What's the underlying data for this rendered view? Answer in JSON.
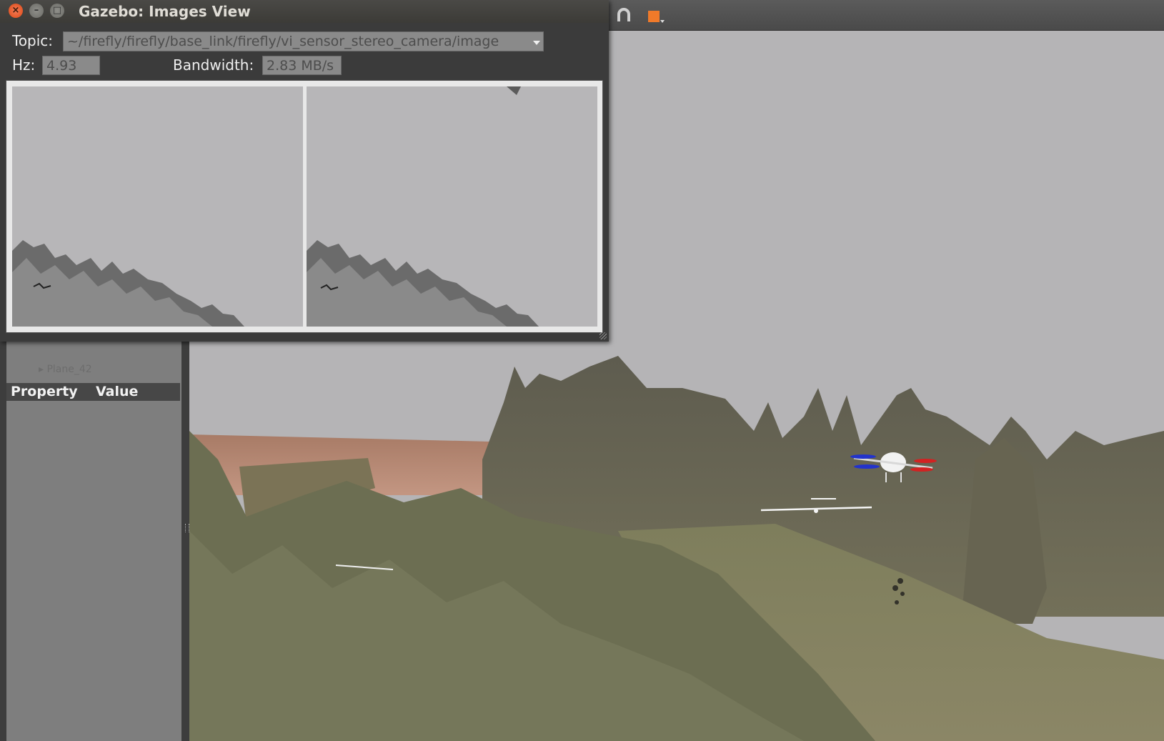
{
  "images_view": {
    "window_title": "Gazebo: Images View",
    "topic_label": "Topic:",
    "topic_value": "~/firefly/firefly/base_link/firefly/vi_sensor_stereo_camera/image",
    "hz_label": "Hz:",
    "hz_value": "4.93",
    "bandwidth_label": "Bandwidth:",
    "bandwidth_value": "2.83 MB/s"
  },
  "left_panel": {
    "faded_item": "▸ Plane_42",
    "property_header": "Property",
    "value_header": "Value"
  },
  "toolbar": {
    "icons": [
      "translate-icon",
      "magnet-icon",
      "model-icon"
    ]
  },
  "colors": {
    "sky": "#b5b4b6",
    "terrain": "#6f7255",
    "ground_plane": "#b88a73",
    "close_button": "#df4a16"
  }
}
